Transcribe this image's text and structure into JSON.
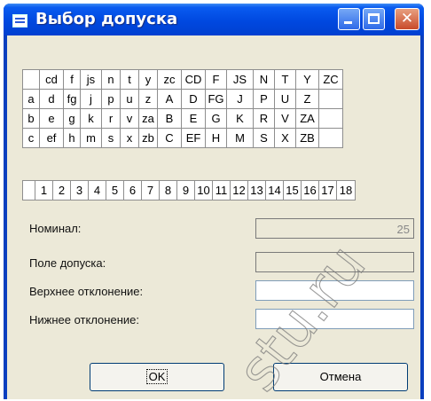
{
  "window": {
    "title": "Выбор допуска"
  },
  "letter_grid": {
    "rows": [
      [
        "",
        "cd",
        "f",
        "js",
        "n",
        "t",
        "y",
        "zc",
        "CD",
        "F",
        "JS",
        "N",
        "T",
        "Y",
        "ZC"
      ],
      [
        "a",
        "d",
        "fg",
        "j",
        "p",
        "u",
        "z",
        "A",
        "D",
        "FG",
        "J",
        "P",
        "U",
        "Z",
        ""
      ],
      [
        "b",
        "e",
        "g",
        "k",
        "r",
        "v",
        "za",
        "B",
        "E",
        "G",
        "K",
        "R",
        "V",
        "ZA",
        ""
      ],
      [
        "c",
        "ef",
        "h",
        "m",
        "s",
        "x",
        "zb",
        "C",
        "EF",
        "H",
        "M",
        "S",
        "X",
        "ZB",
        ""
      ]
    ]
  },
  "grade_row": [
    "",
    "1",
    "2",
    "3",
    "4",
    "5",
    "6",
    "7",
    "8",
    "9",
    "10",
    "11",
    "12",
    "13",
    "14",
    "15",
    "16",
    "17",
    "18"
  ],
  "form": {
    "nominal_label": "Номинал:",
    "nominal_value": "25",
    "field_label": "Поле допуска:",
    "upper_label": "Верхнее отклонение:",
    "lower_label": "Нижнее отклонение:"
  },
  "buttons": {
    "ok": "OK",
    "cancel": "Отмена"
  },
  "watermark": {
    "text": "stu.ru"
  }
}
